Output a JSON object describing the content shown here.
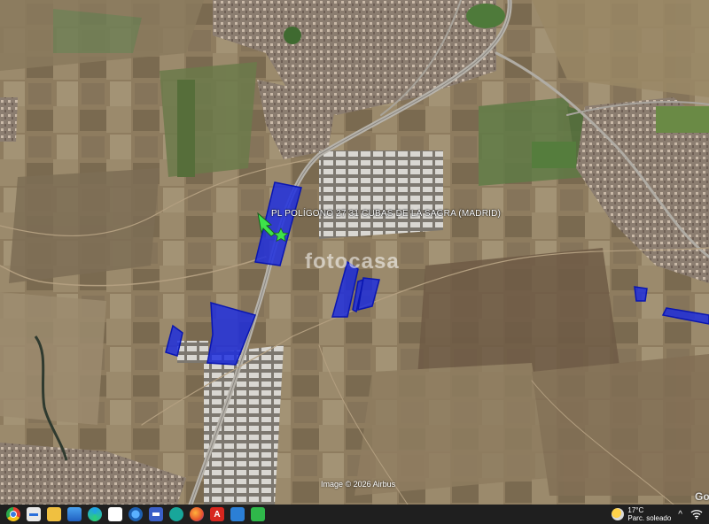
{
  "map": {
    "place_label": "PL POLÍGONO 27 31 CUBAS DE LA SAGRA (MADRID)",
    "watermark": "fotocasa",
    "imagery_credit": "Image © 2026 Airbus",
    "logo_partial": "Goo",
    "polygon_color": "#1a2be0",
    "marker_arrow_color": "#3de34a",
    "marker_star_color": "#3de34a"
  },
  "taskbar": {
    "icons": [
      "chrome-icon",
      "app-icon",
      "explorer-icon",
      "photos-icon",
      "edge-icon",
      "file-icon",
      "maps-icon",
      "save-icon",
      "web-icon",
      "firefox-icon",
      "acrobat-icon",
      "snipping-icon",
      "app-green-icon"
    ],
    "weather": {
      "temperature": "17°C",
      "condition": "Parc. soleado"
    },
    "tray_chevron": "^"
  }
}
